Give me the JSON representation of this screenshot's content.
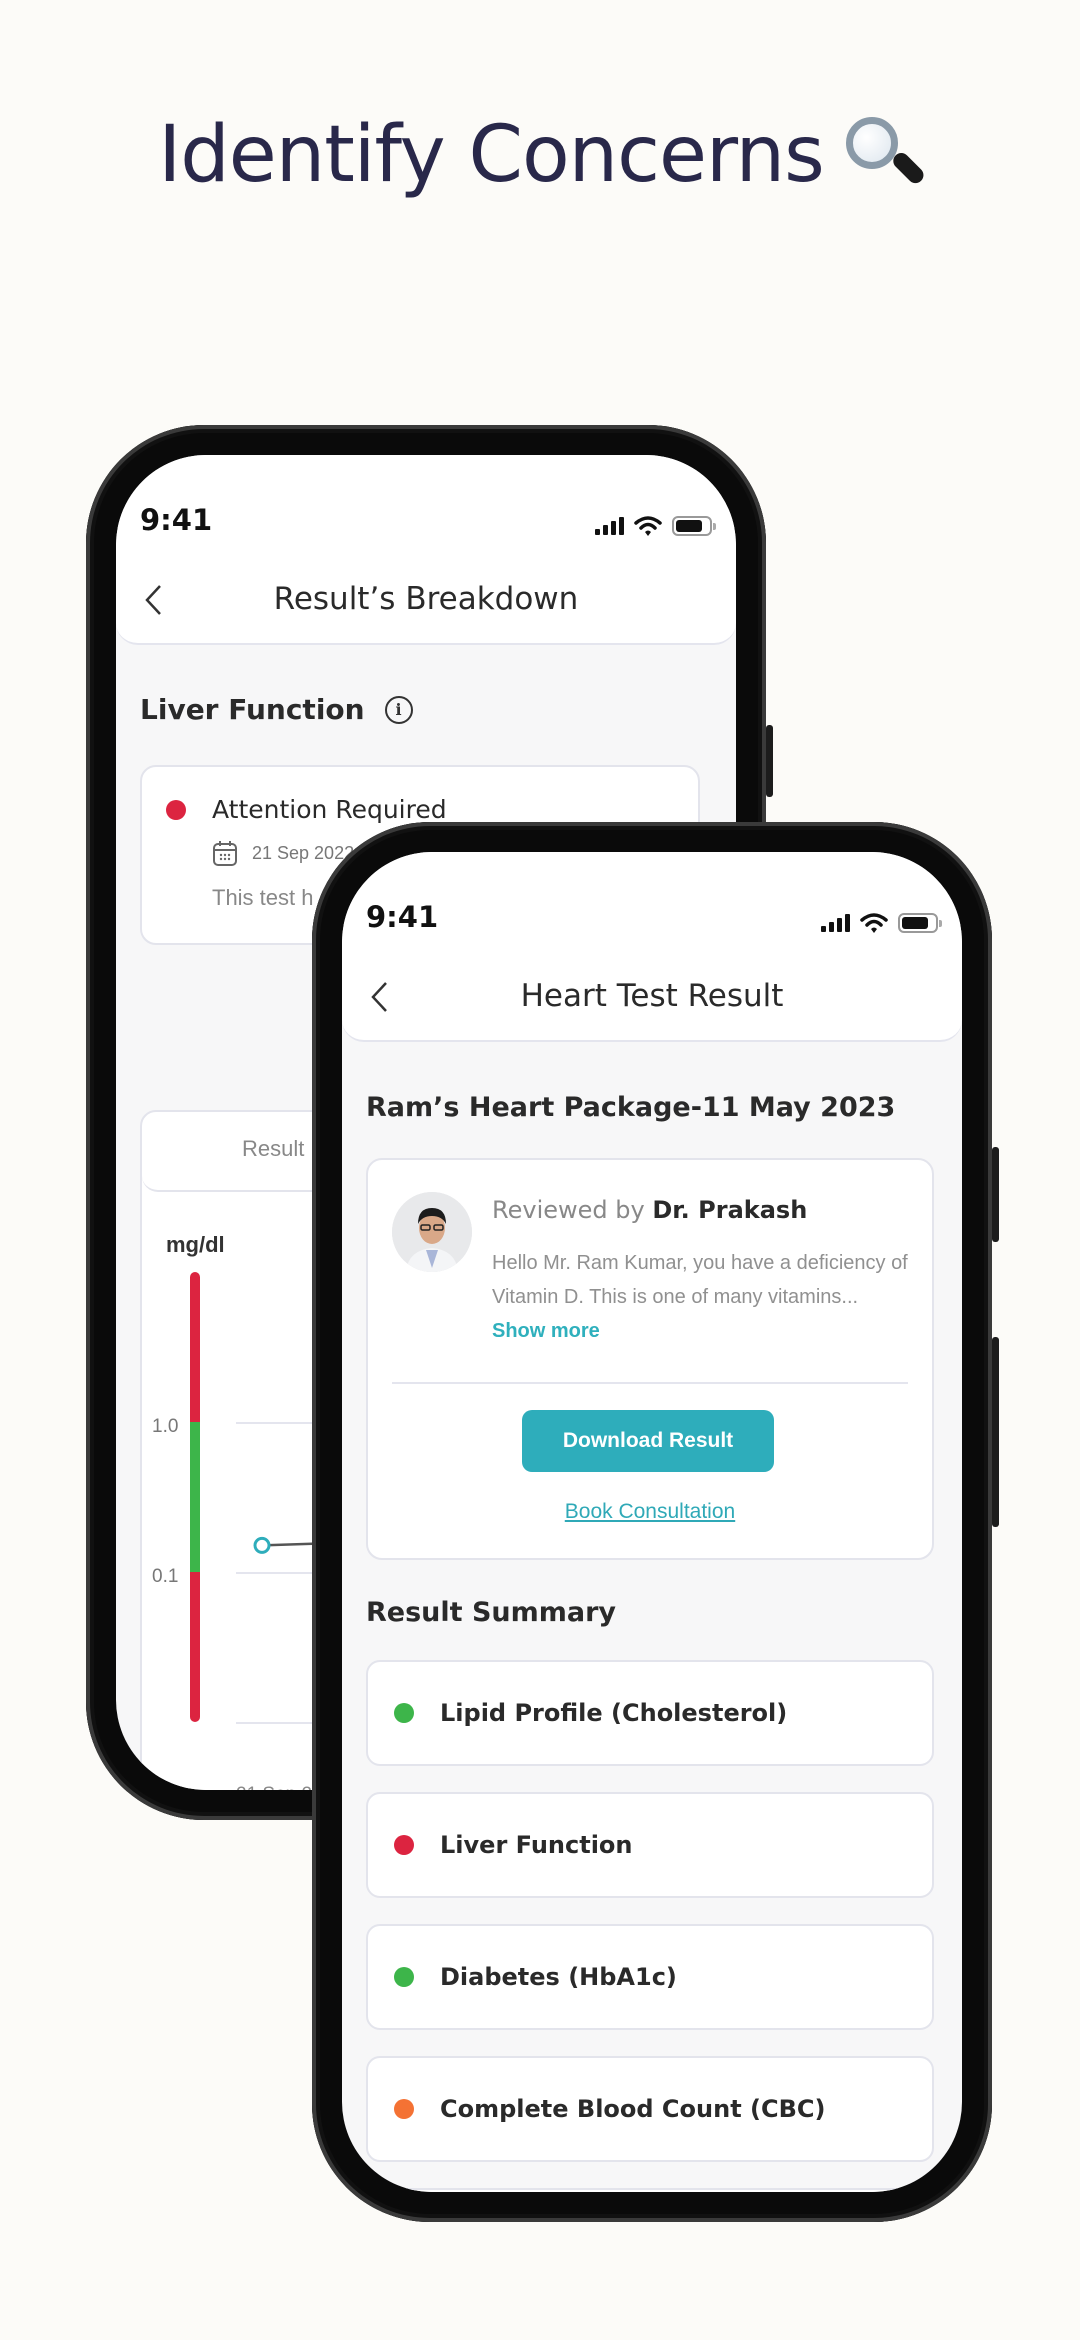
{
  "headline": {
    "text": "Identify Concerns",
    "icon": "magnifying-glass-icon"
  },
  "colors": {
    "title": "#29284a",
    "accent": "#2eadbb",
    "status_red": "#dc2440",
    "status_green": "#3db54a",
    "status_orange": "#f47234"
  },
  "back_phone": {
    "status_bar": {
      "time": "9:41"
    },
    "nav": {
      "title": "Result’s Breakdown",
      "back_icon": "chevron-left-icon"
    },
    "section_title": "Liver Function",
    "info_icon": "info-icon",
    "status_card": {
      "status": "Attention Required",
      "status_color": "red",
      "date": "21 Sep 2022",
      "description": "This test h"
    },
    "chart": {
      "tab_label": "Result",
      "unit": "mg/dl"
    }
  },
  "chart_data": {
    "type": "line",
    "title": "",
    "ylabel": "mg/dl",
    "y_ticks": [
      "1.0",
      "0.1"
    ],
    "x": [
      "21 Sep 2022"
    ],
    "x_label_visible": "21 Sep 2",
    "series": [
      {
        "name": "Liver Function",
        "values": [
          0.5
        ]
      }
    ],
    "reference_range": {
      "normal_low": 0.1,
      "normal_high": 1.0
    },
    "range_bands": [
      {
        "label": "high",
        "color": "#dc2440"
      },
      {
        "label": "normal",
        "color": "#3db54a"
      },
      {
        "label": "low",
        "color": "#dc2440"
      }
    ],
    "grid": true
  },
  "front_phone": {
    "status_bar": {
      "time": "9:41"
    },
    "nav": {
      "title": "Heart Test Result",
      "back_icon": "chevron-left-icon"
    },
    "package_title": "Ram’s Heart Package-11 May 2023",
    "review": {
      "reviewed_by_prefix": "Reviewed by",
      "doctor_name": "Dr. Prakash",
      "message": "Hello Mr. Ram Kumar, you have a deficiency of Vitamin D. This is one of many vitamins...",
      "show_more": "Show more",
      "download_button": "Download Result",
      "consultation_link": "Book Consultation"
    },
    "summary_title": "Result Summary",
    "summary_items": [
      {
        "label": "Lipid Profile (Cholesterol)",
        "status": "green"
      },
      {
        "label": "Liver Function",
        "status": "red"
      },
      {
        "label": "Diabetes (HbA1c)",
        "status": "green"
      },
      {
        "label": "Complete Blood Count (CBC)",
        "status": "orange"
      },
      {
        "label": "",
        "status": ""
      }
    ]
  }
}
